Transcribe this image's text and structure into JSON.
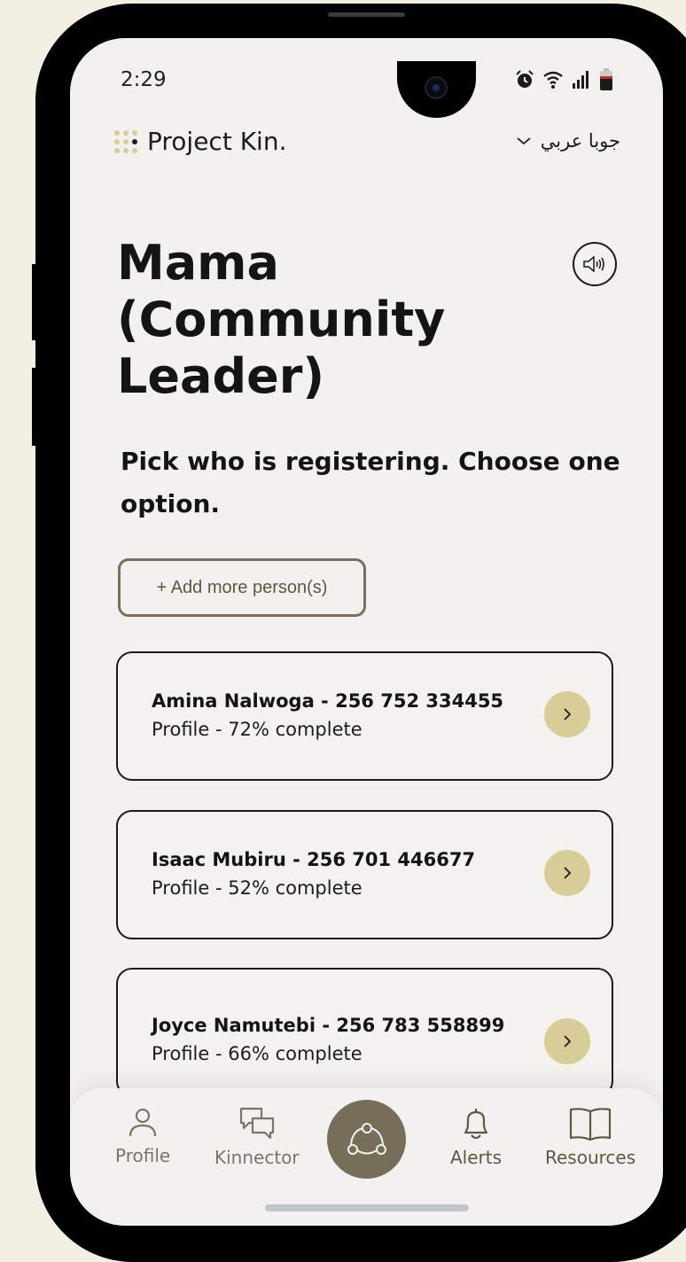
{
  "status_bar": {
    "time": "2:29",
    "icons": [
      "alarm-icon",
      "wifi-icon",
      "signal-icon",
      "battery-icon"
    ]
  },
  "header": {
    "brand": "Project Kin.",
    "language": "جوبا عربي"
  },
  "page": {
    "title": "Mama (Community Leader)",
    "prompt": "Pick who is registering. Choose one option.",
    "add_button": "+ Add more person(s)"
  },
  "people": [
    {
      "name": "Amina Nalwoga - 256 752 334455",
      "profile": "Profile - 72% complete"
    },
    {
      "name": "Isaac Mubiru - 256 701 446677",
      "profile": "Profile - 52% complete"
    },
    {
      "name": "Joyce Namutebi - 256 783 558899",
      "profile": "Profile - 66% complete"
    }
  ],
  "nav": {
    "profile": "Profile",
    "kinnector": "Kinnector",
    "alerts": "Alerts",
    "resources": "Resources"
  },
  "colors": {
    "accent": "#766e58",
    "arrow_bg": "#d8cd98",
    "background": "#f3efe3",
    "screen": "#f2f1ef"
  }
}
